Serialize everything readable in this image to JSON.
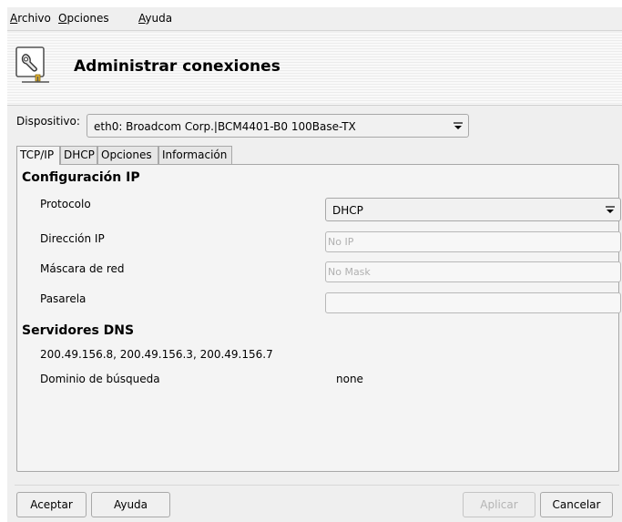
{
  "menubar": {
    "items": [
      {
        "key": "A",
        "rest": "rchivo"
      },
      {
        "key": "O",
        "rest": "pciones"
      },
      {
        "key": "A",
        "rest": "yuda"
      }
    ]
  },
  "header": {
    "title": "Administrar conexiones",
    "icon": "network-connection-wrench-icon"
  },
  "device": {
    "label": "Dispositivo:",
    "selected": "eth0: Broadcom Corp.|BCM4401-B0 100Base-TX"
  },
  "tabs": [
    {
      "label": "TCP/IP",
      "active": true
    },
    {
      "label": "DHCP",
      "active": false
    },
    {
      "label": "Opciones",
      "active": false
    },
    {
      "label": "Información",
      "active": false
    }
  ],
  "ip_config": {
    "title": "Configuración IP",
    "protocol_label": "Protocolo",
    "protocol_value": "DHCP",
    "ip_label": "Dirección IP",
    "ip_placeholder": "No IP",
    "mask_label": "Máscara de red",
    "mask_placeholder": "No Mask",
    "gateway_label": "Pasarela",
    "gateway_value": ""
  },
  "dns": {
    "title": "Servidores DNS",
    "servers": "200.49.156.8, 200.49.156.3, 200.49.156.7",
    "domain_label": "Dominio de búsqueda",
    "domain_value": "none"
  },
  "buttons": {
    "accept": "Aceptar",
    "help": "Ayuda",
    "apply": "Aplicar",
    "cancel": "Cancelar"
  },
  "colors": {
    "window_bg": "#efefef",
    "panel_bg": "#f4f4f4",
    "border": "#a8a8a8",
    "disabled_text": "#b4b4b4"
  }
}
